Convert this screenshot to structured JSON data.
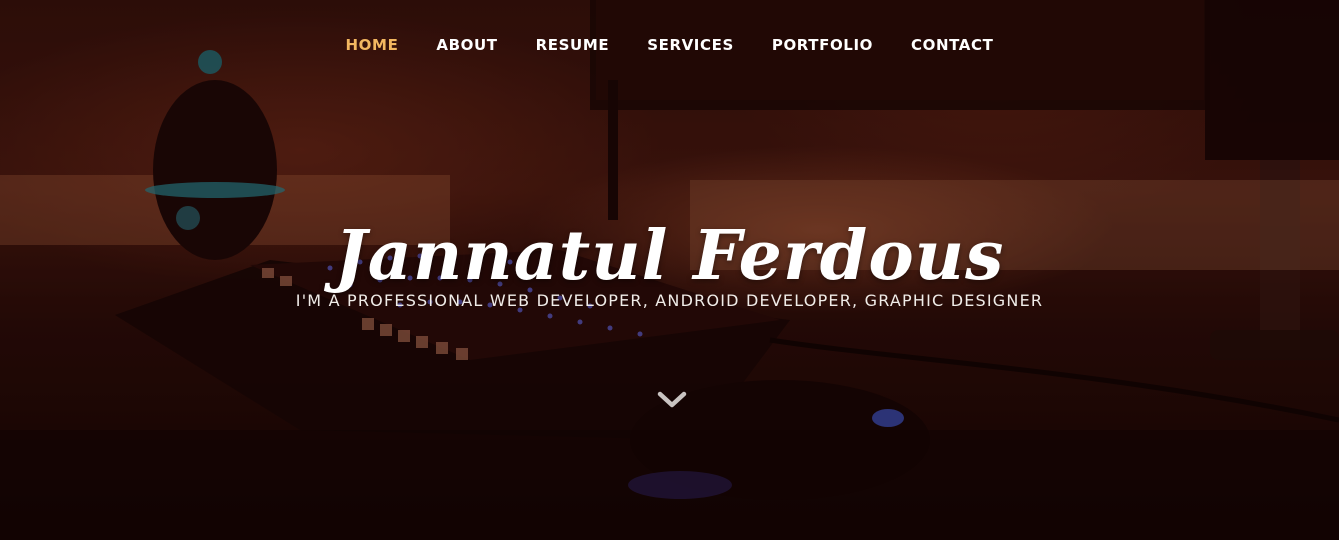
{
  "nav": {
    "items": [
      {
        "label": "HOME",
        "active": true
      },
      {
        "label": "ABOUT",
        "active": false
      },
      {
        "label": "RESUME",
        "active": false
      },
      {
        "label": "SERVICES",
        "active": false
      },
      {
        "label": "PORTFOLIO",
        "active": false
      },
      {
        "label": "CONTACT",
        "active": false
      }
    ]
  },
  "hero": {
    "name": "Jannatul Ferdous",
    "tagline": "I'M A PROFESSIONAL WEB DEVELOPER, ANDROID DEVELOPER, GRAPHIC DESIGNER",
    "scroll_icon": "chevron-down-icon"
  },
  "colors": {
    "nav_text": "#ffffff",
    "nav_active": "#f2b760",
    "background_tint": "#2b0d08"
  }
}
